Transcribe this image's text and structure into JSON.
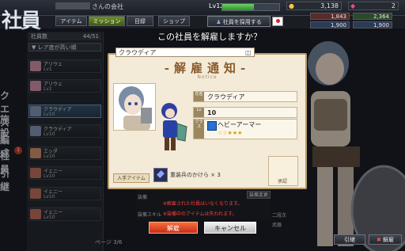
{
  "header": {
    "big_title": "社員",
    "company_suffix": "さんの会社",
    "level_label": "Lv",
    "level_value": "12",
    "level_progress": 0.55,
    "coins": "3,138",
    "gems": "2"
  },
  "tabs": [
    {
      "label": "アイテム"
    },
    {
      "label": "ミッション"
    },
    {
      "label": "目録"
    },
    {
      "label": "ショップ"
    }
  ],
  "hire_button": "社員を採用する",
  "right_stats": [
    "1,843",
    "2,364",
    "1,900",
    "1,900"
  ],
  "left_panel": {
    "header_label": "社員数",
    "header_count": "44/51",
    "filter_label": "▼ レア度が高い順",
    "employees": [
      {
        "name": "アリウェ",
        "lv": "Lv1",
        "color": "#c88aa0"
      },
      {
        "name": "アリウェ",
        "lv": "Lv1",
        "color": "#c88aa0"
      },
      {
        "name": "クラウディア",
        "lv": "Lv10",
        "color": "#7e8fb0"
      },
      {
        "name": "クラウディア",
        "lv": "Lv10",
        "color": "#7e8fb0"
      },
      {
        "name": "エッダ",
        "lv": "Lv10",
        "color": "#c98a6a"
      },
      {
        "name": "イェニー",
        "lv": "Lv10",
        "color": "#b76a5a"
      },
      {
        "name": "イェニー",
        "lv": "Lv10",
        "color": "#b76a5a"
      },
      {
        "name": "イェニー",
        "lv": "Lv10",
        "color": "#b76a5a"
      }
    ],
    "page_label": "ページ 3/6"
  },
  "sidebar": [
    {
      "label": "クエスト"
    },
    {
      "label": "施設"
    },
    {
      "label": "編成"
    },
    {
      "label": "社員"
    },
    {
      "label": "引継"
    }
  ],
  "sidebar_badge": "1",
  "background_detail": {
    "equip_label": "装備",
    "skill_label": "装備スキル",
    "equip_change": "装備変更",
    "second_slot": "二段次",
    "weapon_slot": "武器"
  },
  "dialog": {
    "question": "この社員を解雇しますか？",
    "top_name": "クラウディア",
    "title": "-解雇通知-",
    "subtitle": "Notice",
    "fields": [
      {
        "key": "氏名",
        "value": "クラウディア"
      },
      {
        "key": "Lv",
        "value": "10"
      },
      {
        "key": "クラス",
        "value": "ヘビーアーマー"
      }
    ],
    "rarity_stars": "☆☆★★★",
    "rarity_filled": 2,
    "rarity_total": 5,
    "items_header": "入手アイテム",
    "item_text": "重装兵のかけら × 3",
    "approve_label": "承認"
  },
  "warnings": [
    "※解雇された社員はいなくなります。",
    "※装備中のアイテムは失われます。"
  ],
  "buttons": {
    "fire": "解雇",
    "cancel": "キャンセル",
    "dismiss": "引継",
    "dismiss2": "解雇"
  },
  "colors": {
    "accent_green": "#6f8f2a",
    "dialog_bg": "#f3ead7",
    "fire_button": "#e8482a"
  }
}
